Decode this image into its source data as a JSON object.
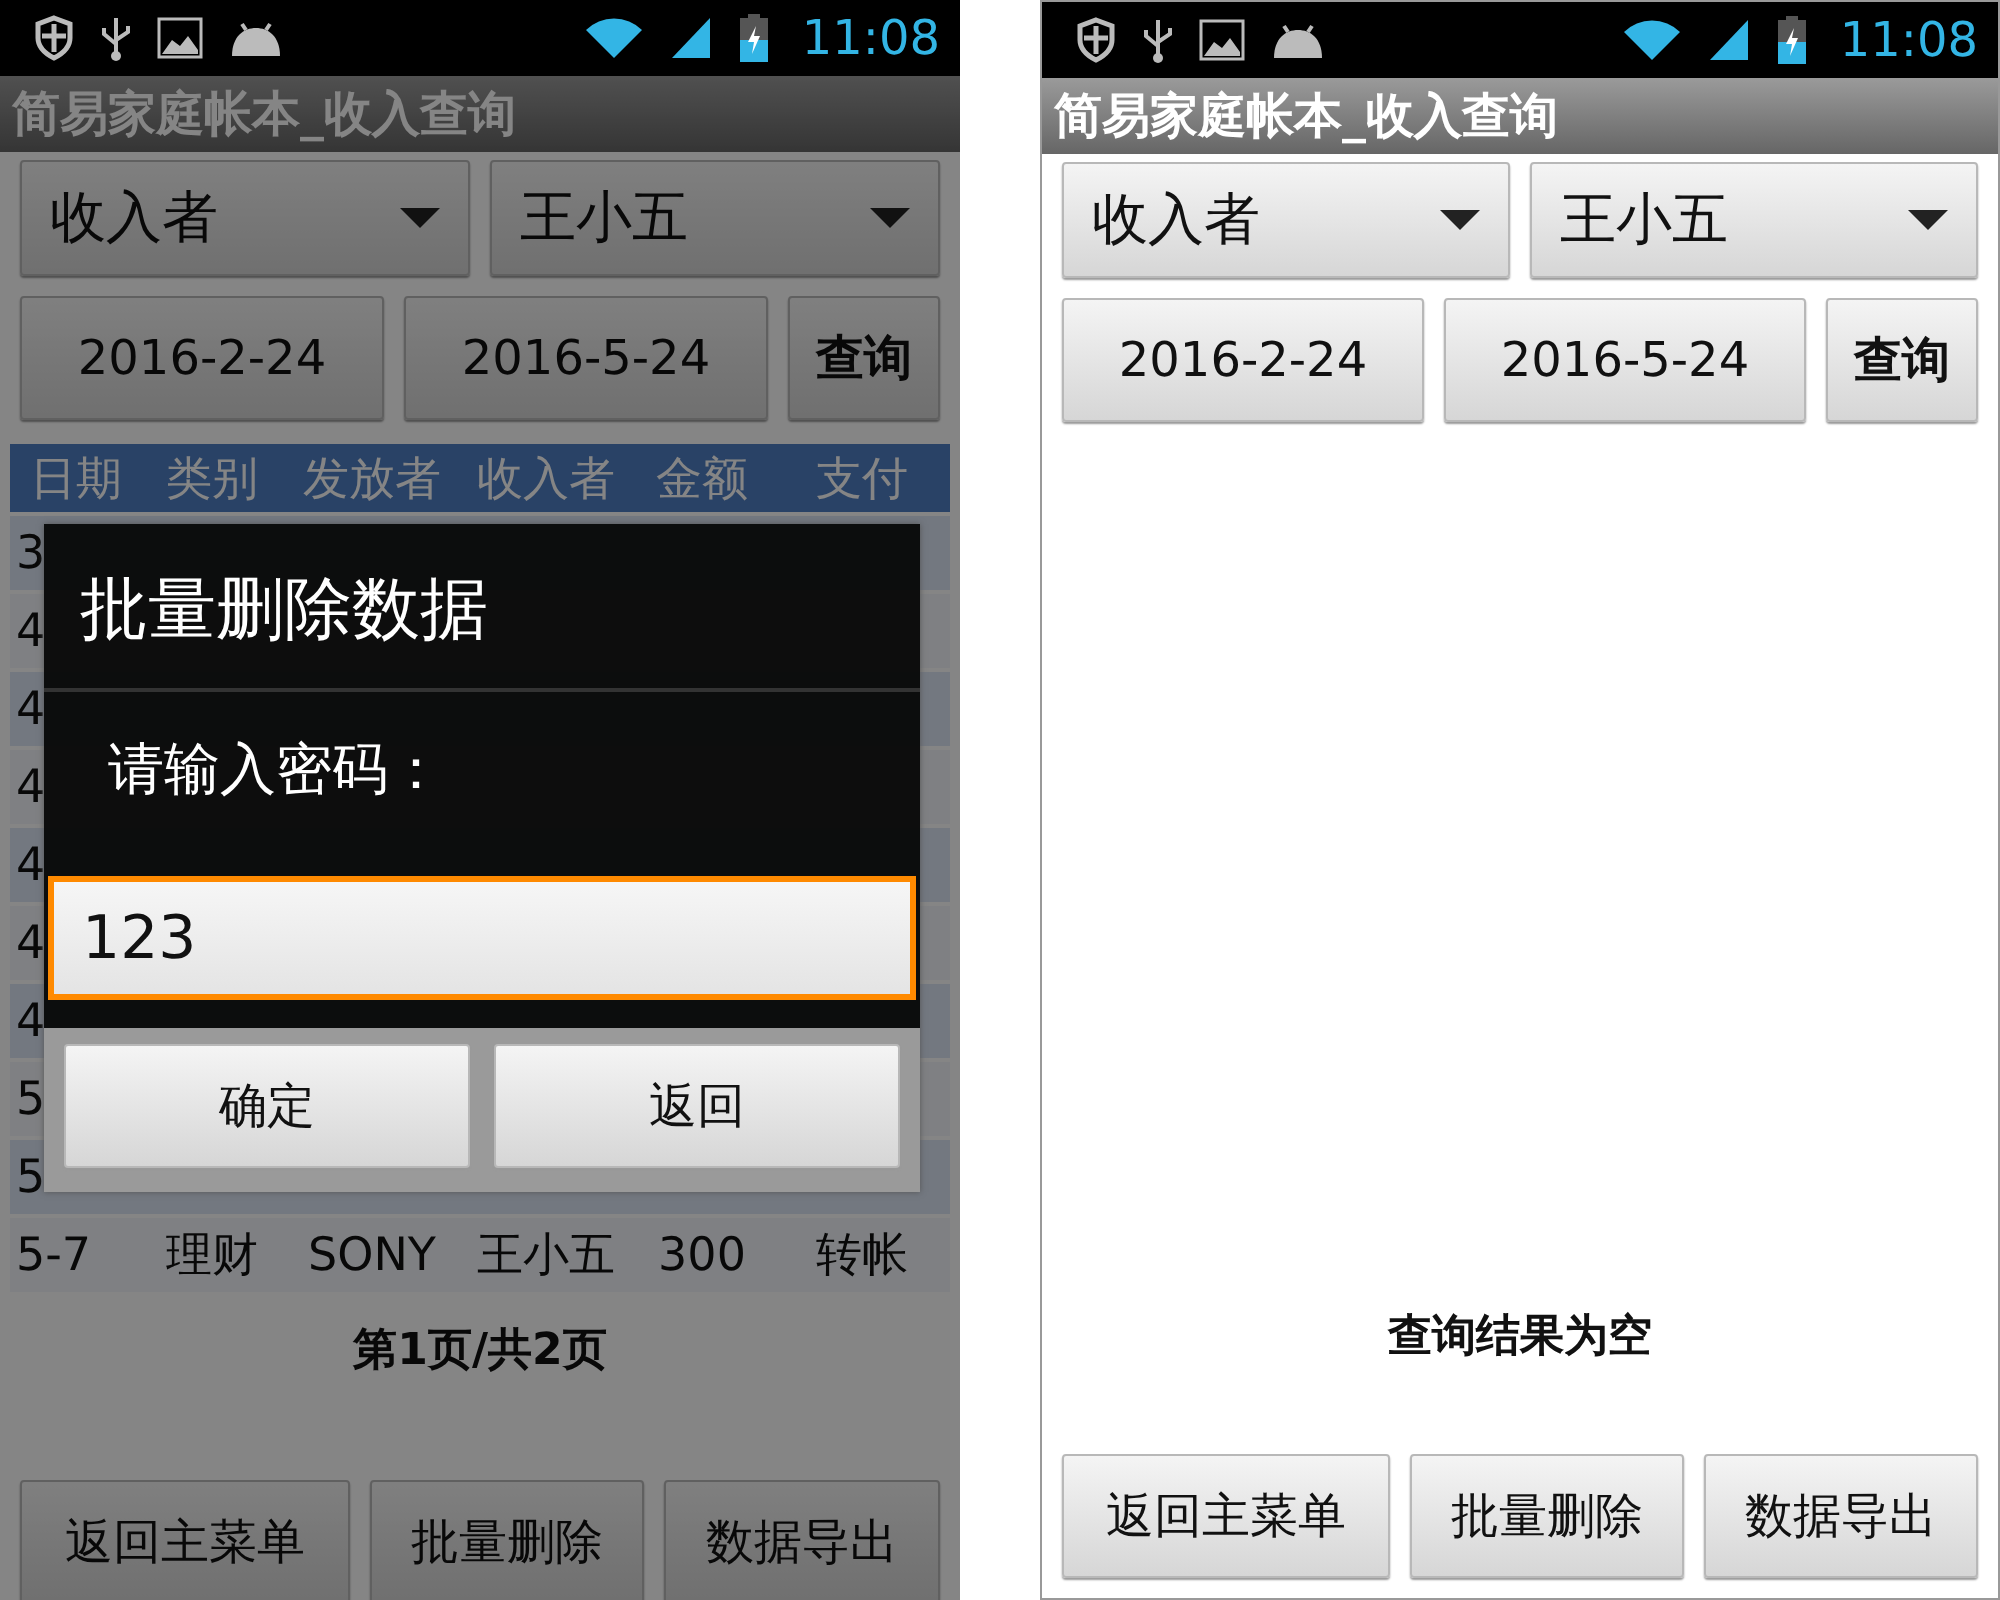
{
  "screens": [
    {
      "time": "11:08",
      "title": "简易家庭帐本_收入查询",
      "filters": [
        "收入者",
        "王小五"
      ],
      "dates": [
        "2016-2-24",
        "2016-5-24"
      ],
      "query": "查询",
      "table": {
        "columns": [
          "日期",
          "类别",
          "发放者",
          "收入者",
          "金额",
          "支付"
        ],
        "rows": [
          {
            "cells": [
              "3"
            ]
          },
          {
            "cells": [
              "4"
            ]
          },
          {
            "cells": [
              "4"
            ]
          },
          {
            "cells": [
              "4"
            ]
          },
          {
            "cells": [
              "4"
            ]
          },
          {
            "cells": [
              "4"
            ]
          },
          {
            "cells": [
              "4"
            ]
          },
          {
            "cells": [
              "5"
            ]
          },
          {
            "cells": [
              "5"
            ]
          },
          {
            "cells": [
              "5-7",
              "理财",
              "SONY",
              "王小五",
              "300",
              "转帐"
            ]
          }
        ]
      },
      "pager": "第1页/共2页",
      "dialog": {
        "title": "批量删除数据",
        "label": "请输入密码：",
        "input": {
          "value": "123",
          "focused": true
        },
        "buttons": [
          "确定",
          "返回"
        ]
      },
      "buttons": [
        "返回主菜单",
        "批量删除",
        "数据导出"
      ]
    },
    {
      "time": "11:08",
      "title": "简易家庭帐本_收入查询",
      "filters": [
        "收入者",
        "王小五"
      ],
      "dates": [
        "2016-2-24",
        "2016-5-24"
      ],
      "query": "查询",
      "message": "查询结果为空",
      "buttons": [
        "返回主菜单",
        "批量删除",
        "数据导出"
      ]
    }
  ]
}
